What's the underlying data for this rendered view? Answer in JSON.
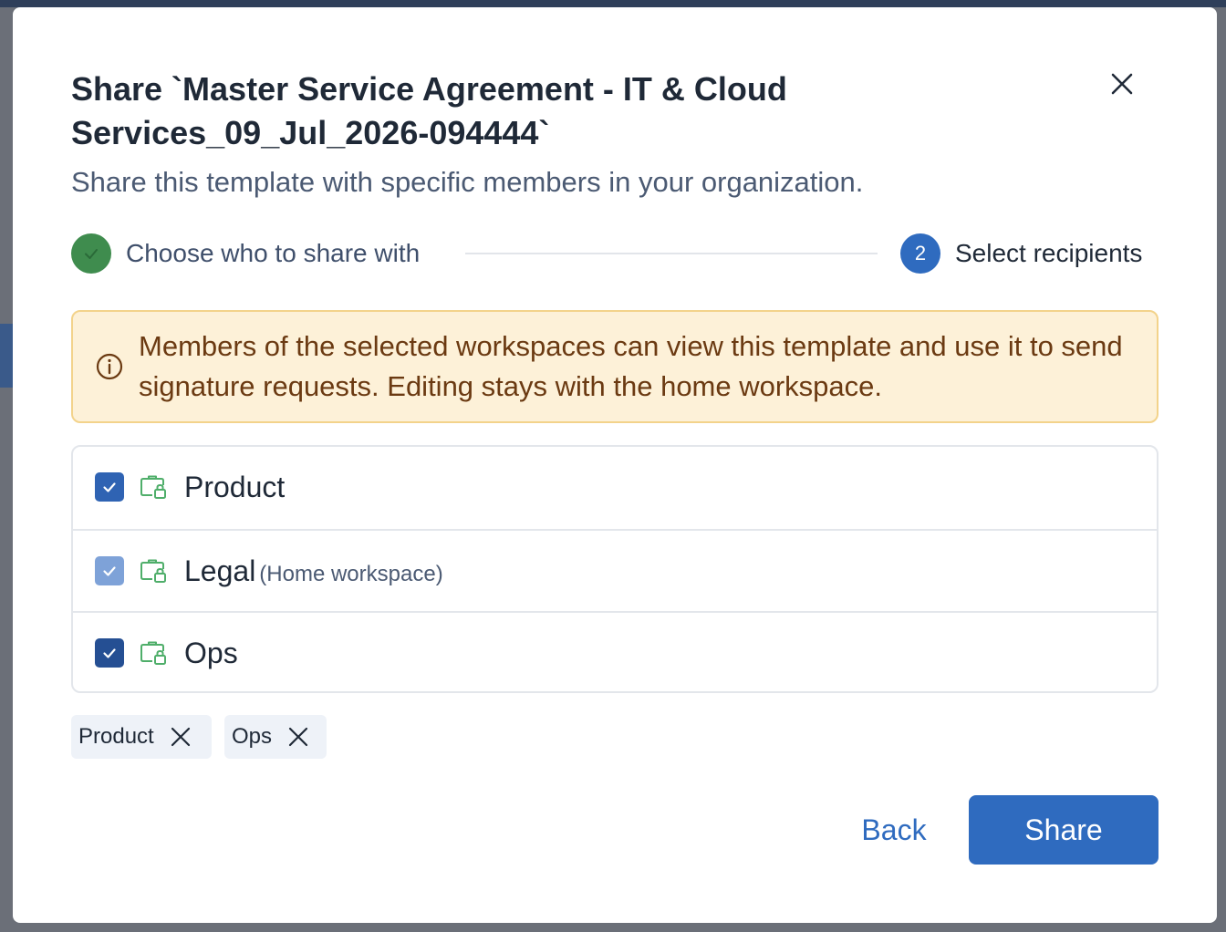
{
  "dialog": {
    "title": "Share `Master Service Agreement - IT & Cloud Services_09_Jul_2026-094444`",
    "subtitle": "Share this template with specific members in your organization.",
    "close_icon": "close-icon"
  },
  "stepper": {
    "steps": [
      {
        "label": "Choose who to share with",
        "status": "completed",
        "icon": "check-icon"
      },
      {
        "label": "Select recipients",
        "number": "2",
        "status": "current"
      }
    ]
  },
  "notice": {
    "icon": "info-icon",
    "text": "Members of the selected workspaces can view this template and use it to send signature requests. Editing stays with the home workspace."
  },
  "workspaces": [
    {
      "name": "Product",
      "suffix": "",
      "checked": true,
      "disabled": false,
      "icon": "workspace-lock-icon"
    },
    {
      "name": "Legal",
      "suffix": "(Home workspace)",
      "checked": true,
      "disabled": true,
      "icon": "workspace-lock-icon"
    },
    {
      "name": "Ops",
      "suffix": "",
      "checked": true,
      "disabled": false,
      "icon": "workspace-lock-icon"
    }
  ],
  "selected_chips": [
    {
      "label": "Product"
    },
    {
      "label": "Ops"
    }
  ],
  "footer": {
    "back_label": "Back",
    "share_label": "Share"
  },
  "colors": {
    "primary": "#2f6bbf",
    "success": "#3f8c4e",
    "warning_bg": "#fdf1d8",
    "warning_text": "#6b3a12"
  }
}
